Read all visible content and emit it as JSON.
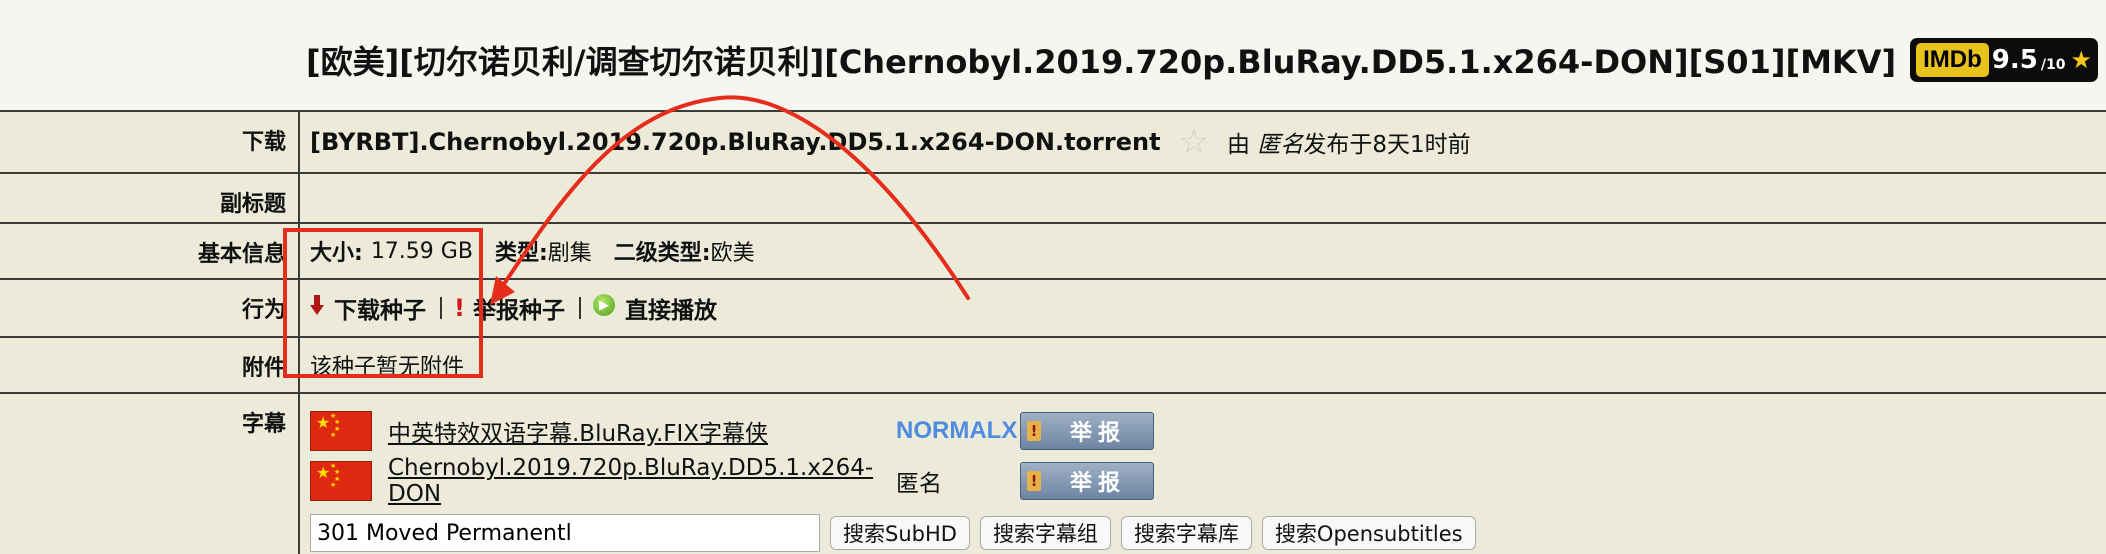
{
  "title": {
    "text": "[欧美][切尔诺贝利/调查切尔诺贝利][Chernobyl.2019.720p.BluRay.DD5.1.x264-DON][S01][MKV]",
    "imdb_logo": "IMDb",
    "imdb_score": "9.5",
    "imdb_max": "/10",
    "imdb_star": "★"
  },
  "rows": {
    "download": {
      "label": "下载",
      "torrent_name": "[BYRBT].Chernobyl.2019.720p.BluRay.DD5.1.x264-DON.torrent",
      "bookmark_star": "☆",
      "uploader_prefix": "由",
      "uploader_name": "匿名",
      "uploader_suffix": "发布于8天1时前"
    },
    "subtitle": {
      "label": "副标题",
      "value": ""
    },
    "basic_info": {
      "label": "基本信息",
      "size_label": "大小:",
      "size_value": "17.59 GB",
      "type_label": "类型:",
      "type_value": "剧集",
      "subtype_label": "二级类型:",
      "subtype_value": "欧美"
    },
    "actions": {
      "label": "行为",
      "download_label": "下载种子",
      "report_label": "举报种子",
      "play_label": "直接播放"
    },
    "attachments": {
      "label": "附件",
      "value": "该种子暂无附件"
    },
    "subtitles": {
      "label": "字幕",
      "items": [
        {
          "name": "中英特效双语字幕.BluRay.FIX字幕侠",
          "uploader": "NORMALX",
          "report_label": "举报"
        },
        {
          "name": "Chernobyl.2019.720p.BluRay.DD5.1.x264-DON",
          "uploader": "匿名",
          "report_label": "举报"
        }
      ],
      "search_value": "301 Moved Permanentl",
      "search_buttons": [
        "搜索SubHD",
        "搜索字幕组",
        "搜索字幕库",
        "搜索Opensubtitles"
      ]
    }
  },
  "colors": {
    "annotation_red": "#e62d1b",
    "table_bg": "#ecebd9",
    "page_bg": "#f6f6f0",
    "imdb_yellow": "#e8c21d",
    "normalx_blue": "#4d8ce0"
  },
  "icons": {
    "download": "arrow-down-icon",
    "report": "exclamation-icon",
    "play": "play-circle-icon",
    "bookmark": "star-outline-icon",
    "flag": "china-flag-icon"
  }
}
